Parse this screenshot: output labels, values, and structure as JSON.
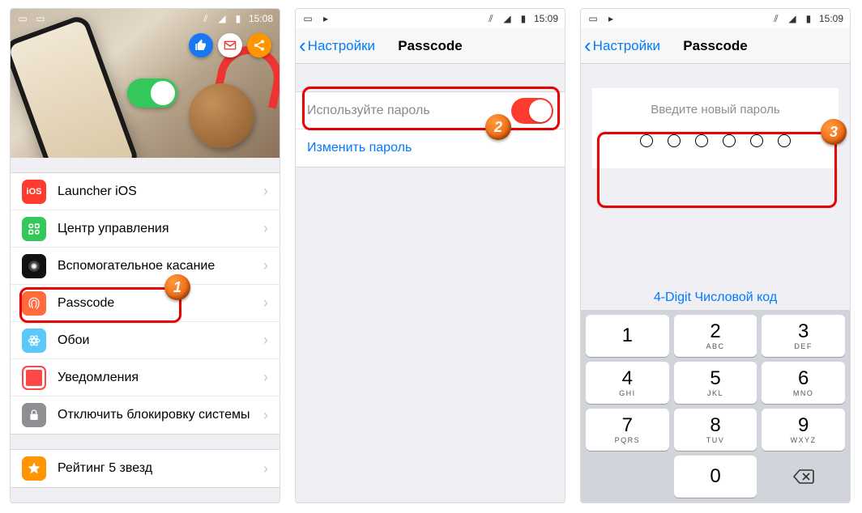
{
  "status": {
    "time": "15:08",
    "time_alt": "15:09"
  },
  "phone1": {
    "rows": [
      {
        "icon": "ai-red",
        "label": "Launcher iOS",
        "txt": "iOS"
      },
      {
        "icon": "ai-green",
        "label": "Центр управления"
      },
      {
        "icon": "ai-black",
        "label": "Вспомогательное касание"
      },
      {
        "icon": "ai-finger",
        "label": "Passcode"
      },
      {
        "icon": "ai-blue",
        "label": "Обои"
      },
      {
        "icon": "ai-photo",
        "label": "Уведомления"
      },
      {
        "icon": "ai-grey",
        "label": "Отключить блокировку системы"
      },
      {
        "icon": "ai-star",
        "label": "Рейтинг 5 звезд"
      }
    ]
  },
  "phone2": {
    "back": "Настройки",
    "title": "Passcode",
    "use_password": "Используйте пароль",
    "change_password": "Изменить пароль"
  },
  "phone3": {
    "back": "Настройки",
    "title": "Passcode",
    "prompt": "Введите новый пароль",
    "fourdigit": "4-Digit Числовой код",
    "keys": [
      {
        "n": "1",
        "l": ""
      },
      {
        "n": "2",
        "l": "ABC"
      },
      {
        "n": "3",
        "l": "DEF"
      },
      {
        "n": "4",
        "l": "GHI"
      },
      {
        "n": "5",
        "l": "JKL"
      },
      {
        "n": "6",
        "l": "MNO"
      },
      {
        "n": "7",
        "l": "PQRS"
      },
      {
        "n": "8",
        "l": "TUV"
      },
      {
        "n": "9",
        "l": "WXYZ"
      }
    ],
    "zero": "0"
  },
  "badges": {
    "b1": "1",
    "b2": "2",
    "b3": "3"
  }
}
